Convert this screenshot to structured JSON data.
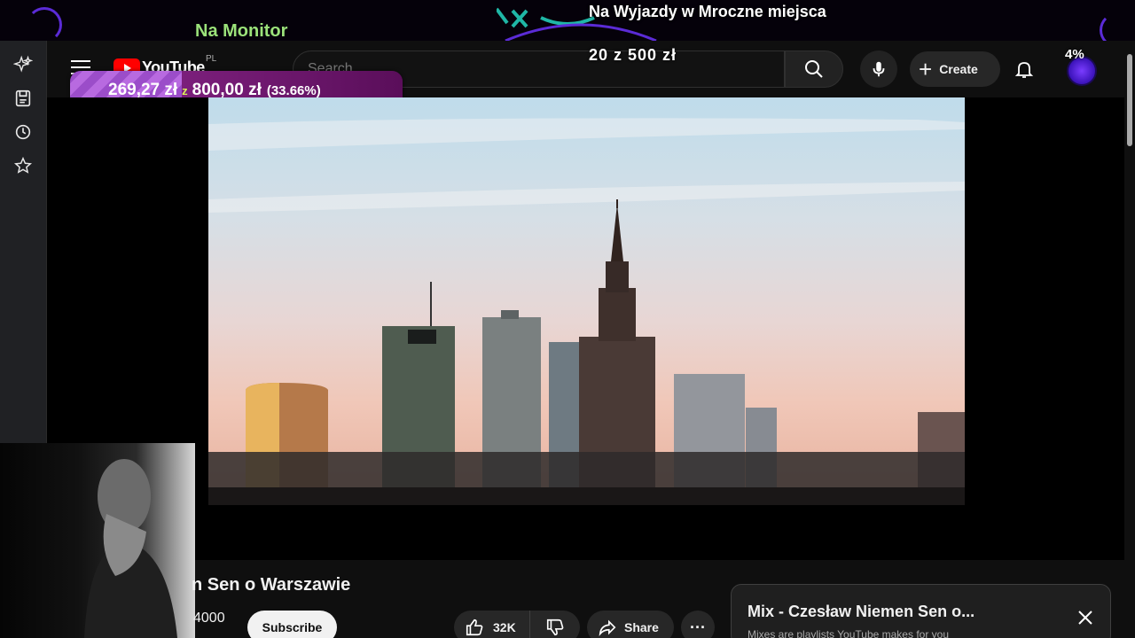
{
  "overlay": {
    "monitor_label": "Na Monitor",
    "goal_title": "Na Wyjazdy w Mroczne miejsca",
    "goal_count": "20 z 500 zł",
    "top_percent": "4%"
  },
  "donation": {
    "current": "269,27 zł",
    "separator": "z",
    "target": "800,00 zł",
    "percent_label": "(33.66%)",
    "progress_fraction": 0.3366
  },
  "sidebar_strip": {
    "icons": [
      "sparkle-icon",
      "save-icon",
      "history-icon",
      "star-icon"
    ]
  },
  "header": {
    "logo_text": "YouTube",
    "country_code": "PL",
    "search_placeholder": "Search",
    "create_label": "Create"
  },
  "video": {
    "title_fragment": "n Sen o Warszawie",
    "subscriber_count": "4000",
    "subscribe_label": "Subscribe",
    "like_count": "32K",
    "share_label": "Share",
    "more_label": "···"
  },
  "mix": {
    "title": "Mix - Czesław Niemen Sen o...",
    "subtitle": "Mixes are playlists YouTube makes for you"
  },
  "colors": {
    "accent_red": "#ff0000",
    "donation_fill": "#9b4dc9",
    "monitor_green": "#9be27a"
  }
}
